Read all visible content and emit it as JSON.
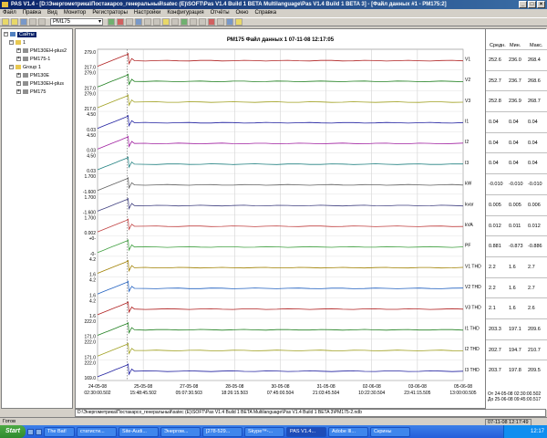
{
  "window": {
    "title": "PAS V1.4 - [D:\\Энергометрика\\Постакарсо_генеральный\\satec (E)\\SOFT\\Pas V1.4 Build 1 BETA Multilanguage\\Pas V1.4 Build 1 BETA 3] - [Файл данных #1 - PM175:2]",
    "min": "_",
    "max": "□",
    "close": "×"
  },
  "menu": [
    "Файл",
    "Правка",
    "Вид",
    "Монитор",
    "Регистраторы",
    "Настройки",
    "Конфигурация",
    "Отчёты",
    "Окно",
    "Справка"
  ],
  "toolbar": {
    "device": "PM175"
  },
  "tree": {
    "root": "Сайты",
    "group1": "1",
    "items1": [
      "PM130EH-plus2",
      "PM175-1"
    ],
    "group2": "Group 1",
    "items2": [
      "PM130E",
      "PM130EH-plus",
      "PM175"
    ]
  },
  "chart": {
    "title": "PM175  Файл данных 1  07-11-08 12:17:05",
    "x_ticks": [
      {
        "date": "24-05-08",
        "time": "02:30:00.502"
      },
      {
        "date": "25-05-08",
        "time": "15:48:45.502"
      },
      {
        "date": "27-05-08",
        "time": "05:07:30.503"
      },
      {
        "date": "28-05-08",
        "time": "18:26:15.503"
      },
      {
        "date": "30-05-08",
        "time": "07:45:00.504"
      },
      {
        "date": "31-05-08",
        "time": "21:03:45.504"
      },
      {
        "date": "02-06-08",
        "time": "10:22:30.504"
      },
      {
        "date": "03-06-08",
        "time": "23:41:15.505"
      },
      {
        "date": "05-06-08",
        "time": "13:00:00.505"
      }
    ],
    "colors": [
      "#b02020",
      "#208020",
      "#a0a020",
      "#2020a0",
      "#a020a0",
      "#208080",
      "#606060",
      "#404080",
      "#c04040",
      "#40a040",
      "#a08000",
      "#2060c0"
    ]
  },
  "chart_data": {
    "type": "line",
    "title": "PM175  Файл данных 1  07-11-08 12:17:05",
    "x_labels": [
      "24-05-08 02:30:00.502",
      "25-05-08 15:48:45.502",
      "27-05-08 05:07:30.503",
      "28-05-08 18:26:15.503",
      "30-05-08 07:45:00.504",
      "31-05-08 21:03:45.504",
      "02-06-08 10:22:30.504",
      "03-06-08 23:41:15.505",
      "05-06-08 13:00:00.505"
    ],
    "series": [
      {
        "name": "V1",
        "ymax": "279.0",
        "ymin": "217.0",
        "avg": "252.6",
        "min": "236.0",
        "max": "268.4"
      },
      {
        "name": "V2",
        "ymax": "279.0",
        "ymin": "217.0",
        "avg": "252.7",
        "min": "236.7",
        "max": "268.6"
      },
      {
        "name": "V3",
        "ymax": "279.0",
        "ymin": "217.0",
        "avg": "252.8",
        "min": "236.9",
        "max": "268.7"
      },
      {
        "name": "I1",
        "ymax": "4.50",
        "ymin": "0.03",
        "avg": "0.04",
        "min": "0.04",
        "max": "0.04"
      },
      {
        "name": "I2",
        "ymax": "4.50",
        "ymin": "0.03",
        "avg": "0.04",
        "min": "0.04",
        "max": "0.04"
      },
      {
        "name": "I3",
        "ymax": "4.50",
        "ymin": "0.03",
        "avg": "0.04",
        "min": "0.04",
        "max": "0.04"
      },
      {
        "name": "kW",
        "ymax": "1.700",
        "ymin": "-1.600",
        "avg": "-0.010",
        "min": "-0.010",
        "max": "-0.010"
      },
      {
        "name": "kvar",
        "ymax": "1.700",
        "ymin": "-1.600",
        "avg": "0.005",
        "min": "0.005",
        "max": "0.006"
      },
      {
        "name": "kVA",
        "ymax": "1.700",
        "ymin": "0.002",
        "avg": "0.012",
        "min": "0.011",
        "max": "0.012"
      },
      {
        "name": "PF",
        "ymax": "+0-",
        "ymin": "-0-",
        "avg": "0.881",
        "min": "-0.873",
        "max": "-0.886"
      },
      {
        "name": "V1 THD",
        "ymax": "4.2",
        "ymin": "1.6",
        "avg": "2.2",
        "min": "1.6",
        "max": "2.7"
      },
      {
        "name": "V2 THD",
        "ymax": "4.2",
        "ymin": "1.6",
        "avg": "2.2",
        "min": "1.6",
        "max": "2.7"
      },
      {
        "name": "V3 THD",
        "ymax": "4.2",
        "ymin": "1.6",
        "avg": "2.1",
        "min": "1.6",
        "max": "2.6"
      },
      {
        "name": "I1 THD",
        "ymax": "222.0",
        "ymin": "171.0",
        "avg": "203.3",
        "min": "197.1",
        "max": "209.6"
      },
      {
        "name": "I2 THD",
        "ymax": "222.0",
        "ymin": "171.0",
        "avg": "202.7",
        "min": "194.7",
        "max": "210.7"
      },
      {
        "name": "I3 THD",
        "ymax": "222.0",
        "ymin": "169.0",
        "avg": "203.7",
        "min": "197.8",
        "max": "209.5"
      }
    ]
  },
  "stats": {
    "headers": [
      "Средн.",
      "Мин.",
      "Макс."
    ],
    "from": "От 24-05-08 02:30:00.502",
    "to": "До 25-06-08 09:45:00.517"
  },
  "pathbar": "D:\\Энергометрика\\Постакарсо_генеральный\\satec (E)\\SOFT\\Pas V1.4 Build 1 BETA Multilanguage\\Pas V1.4 Build 1 BETA 3\\PM175-2.ndb",
  "status": {
    "text": "Готов",
    "datetime": "07-11-08 12:17:49"
  },
  "taskbar": {
    "start": "Start",
    "tasks": [
      "The Bat!",
      "статисти...",
      "Site-Audi...",
      "Энергом...",
      "[278-529...",
      "Skype™-...",
      "PAS V1.4...",
      "Adobe Ill...",
      "Скрины"
    ],
    "active_index": 6,
    "clock": "12:17"
  }
}
